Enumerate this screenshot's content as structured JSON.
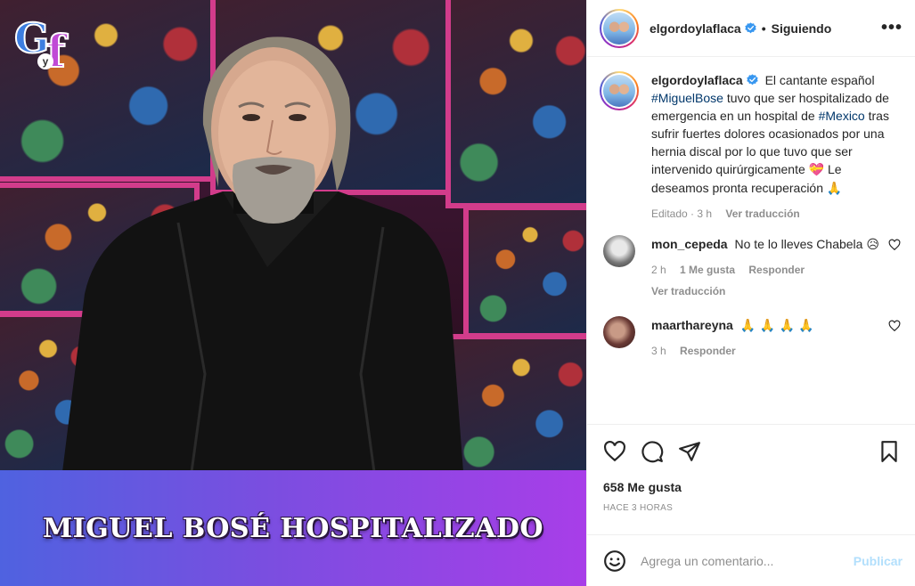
{
  "post": {
    "author": "elgordoylaflaca",
    "follow_status": "Siguiendo",
    "more_label": "•••"
  },
  "media": {
    "logo_g": "G",
    "logo_y": "y",
    "logo_f": "f",
    "banner_text": "MIGUEL BOSÉ HOSPITALIZADO",
    "banner_colors": [
      "#4f62e0",
      "#a83ee8"
    ]
  },
  "caption": {
    "username": "elgordoylaflaca",
    "text_1": "El cantante español",
    "tag_1": "#MiguelBose",
    "text_2": "tuvo que ser hospitalizado de emergencia en un hospital de",
    "tag_2": "#Mexico",
    "text_3": "tras sufrir fuertes dolores ocasionados por una hernia discal por lo que tuvo que ser intervenido quirúrgicamente",
    "emoji_1": "💝",
    "text_4": "Le deseamos pronta recuperación",
    "emoji_2": "🙏",
    "meta_time": "Editado · 3 h",
    "translate": "Ver traducción"
  },
  "comments": [
    {
      "username": "mon_cepeda",
      "text": "No te lo lleves Chabela",
      "emoji": "😥",
      "time": "2 h",
      "likes": "1 Me gusta",
      "reply": "Responder",
      "translate": "Ver traducción"
    },
    {
      "username": "maarthareyna",
      "emoji": "🙏 🙏 🙏 🙏",
      "time": "3 h",
      "reply": "Responder"
    }
  ],
  "stats": {
    "likes": "658 Me gusta",
    "time_ago": "Hace 3 horas"
  },
  "add_comment": {
    "placeholder": "Agrega un comentario...",
    "publish": "Publicar"
  },
  "colors": {
    "verified": "#3897f0",
    "link": "#00376b",
    "publish_disabled": "#b2dffc",
    "muted": "#8e8e8e"
  }
}
